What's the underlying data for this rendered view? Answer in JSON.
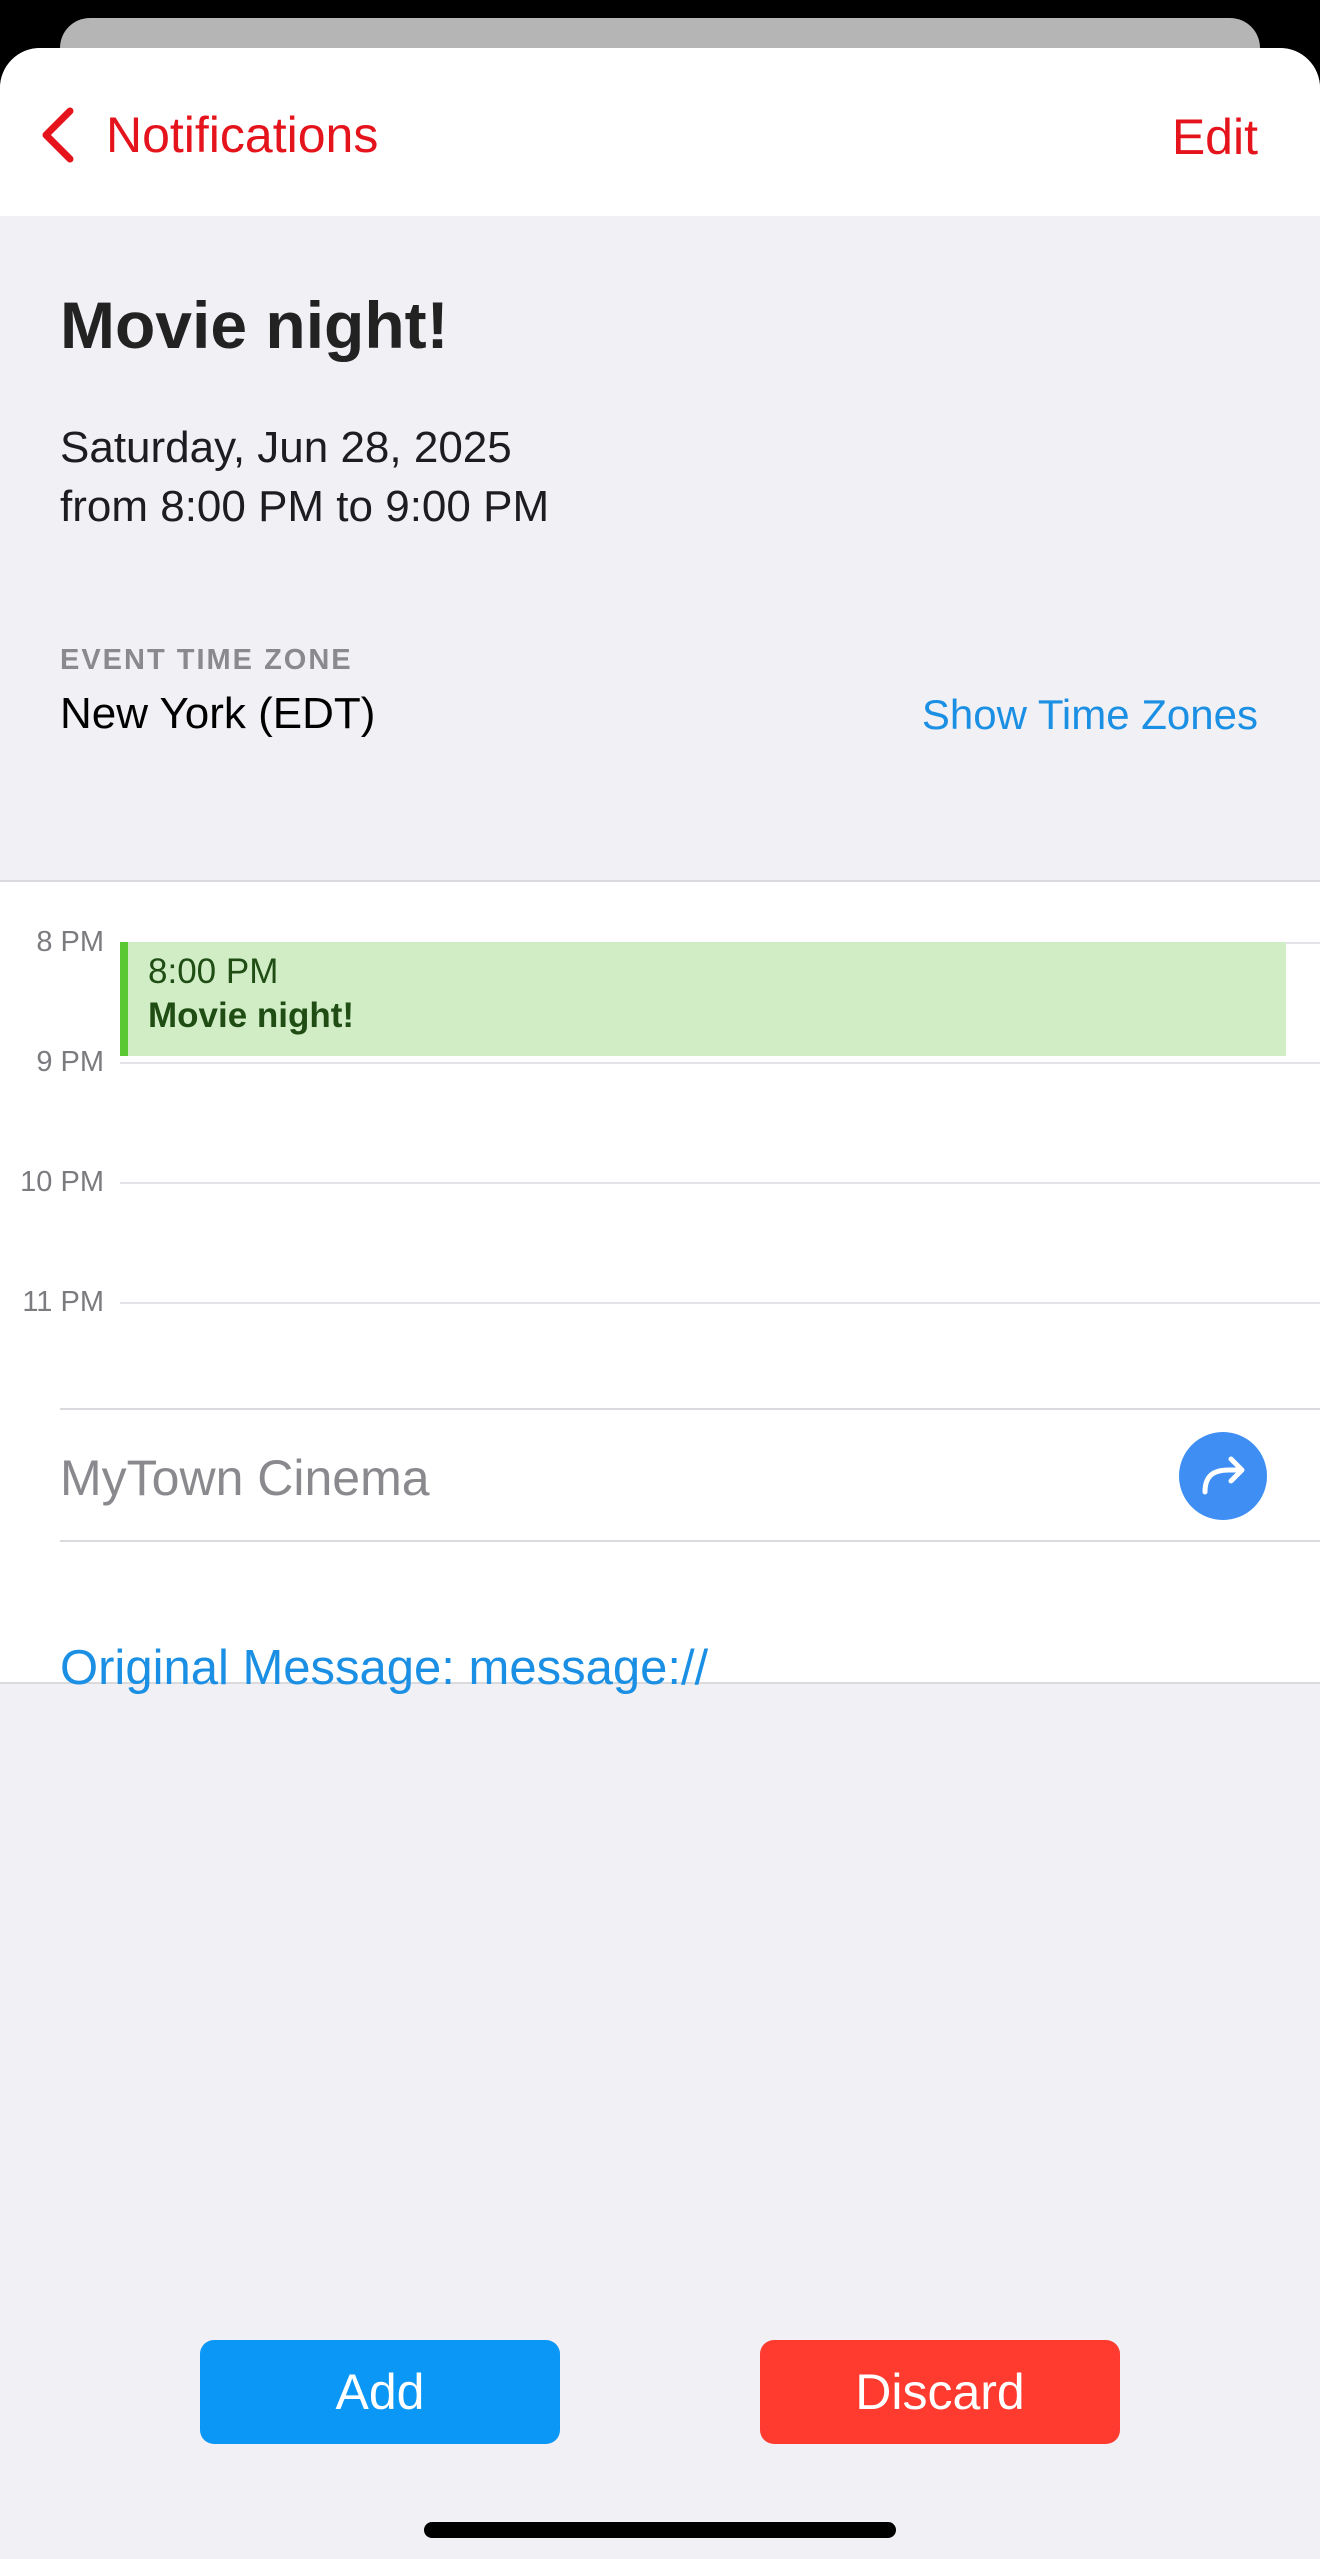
{
  "nav": {
    "back_label": "Notifications",
    "edit_label": "Edit"
  },
  "event": {
    "title": "Movie night!",
    "date_line": "Saturday, Jun 28, 2025",
    "time_line": "from 8:00 PM to 9:00 PM",
    "timezone_caption": "EVENT TIME ZONE",
    "timezone_value": "New York (EDT)",
    "show_timezones_label": "Show Time Zones"
  },
  "timeline": {
    "hours": [
      "8 PM",
      "9 PM",
      "10 PM",
      "11 PM"
    ],
    "event_block": {
      "time": "8:00 PM",
      "title": "Movie night!"
    }
  },
  "location": {
    "name": "MyTown Cinema",
    "directions_icon": "arrow-turn-up-right-icon"
  },
  "original_message": "Original Message: message://",
  "actions": {
    "add_label": "Add",
    "discard_label": "Discard"
  },
  "colors": {
    "accent_red": "#e5141c",
    "link_blue": "#1a8fe3",
    "add_blue": "#0a97f5",
    "discard_red": "#ff3b30",
    "event_fill": "#d0edc6",
    "event_bar": "#5ac832",
    "directions_blue": "#3e8ef4"
  }
}
